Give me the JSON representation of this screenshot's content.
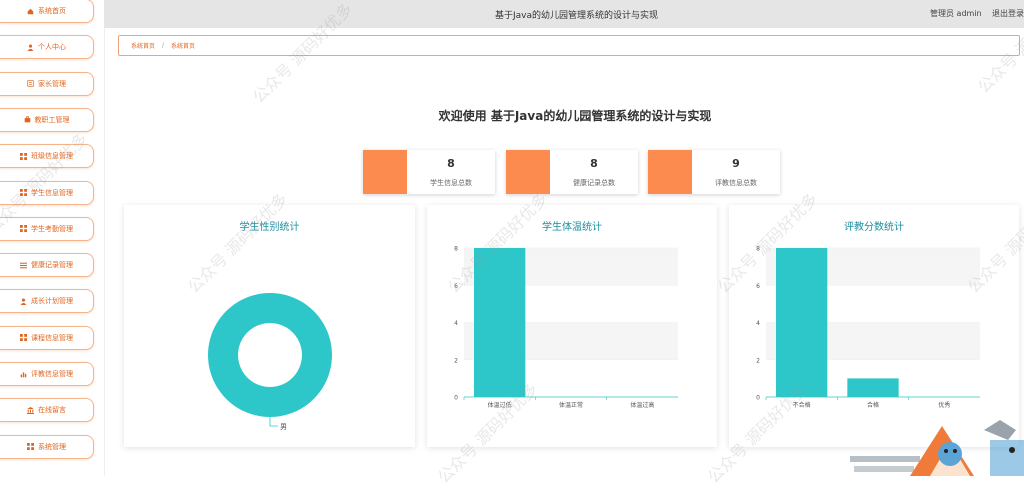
{
  "header": {
    "title": "基于Java的幼儿园管理系统的设计与实现",
    "user": "管理员 admin",
    "logout": "退出登录"
  },
  "sidebar": {
    "items": [
      {
        "label": "系统首页",
        "icon": "home-icon"
      },
      {
        "label": "个人中心",
        "icon": "person-icon"
      },
      {
        "label": "家长管理",
        "icon": "list-icon"
      },
      {
        "label": "教职工管理",
        "icon": "briefcase-icon"
      },
      {
        "label": "班级信息管理",
        "icon": "grid-icon"
      },
      {
        "label": "学生信息管理",
        "icon": "grid-icon"
      },
      {
        "label": "学生考勤管理",
        "icon": "grid-icon"
      },
      {
        "label": "健康记录管理",
        "icon": "menu-icon"
      },
      {
        "label": "成长计划管理",
        "icon": "person-icon"
      },
      {
        "label": "课程信息管理",
        "icon": "grid-icon"
      },
      {
        "label": "评教信息管理",
        "icon": "chart-icon"
      },
      {
        "label": "在线留言",
        "icon": "bank-icon"
      },
      {
        "label": "系统管理",
        "icon": "grid-icon"
      }
    ]
  },
  "breadcrumb": {
    "home": "系统首页",
    "sep": "/",
    "current": "系统首页"
  },
  "welcome": "欢迎使用 基于Java的幼儿园管理系统的设计与实现",
  "stats": [
    {
      "value": "8",
      "label": "学生信息总数"
    },
    {
      "value": "8",
      "label": "健康记录总数"
    },
    {
      "value": "9",
      "label": "评教信息总数"
    }
  ],
  "colors": {
    "accent": "#fb8b4e",
    "chart": "#2ec7c9",
    "title": "#1a8fa0"
  },
  "watermark": "公众号 源码好优多",
  "chart_data": [
    {
      "type": "pie",
      "title": "学生性别统计",
      "categories": [
        "男"
      ],
      "values": [
        8
      ],
      "style": "donut"
    },
    {
      "type": "bar",
      "title": "学生体温统计",
      "categories": [
        "体温过低",
        "体温正常",
        "体温过高"
      ],
      "values": [
        8,
        0,
        0
      ],
      "ylim": [
        0,
        8
      ],
      "yticks": [
        0,
        2,
        4,
        6,
        8
      ]
    },
    {
      "type": "bar",
      "title": "评教分数统计",
      "categories": [
        "不合格",
        "合格",
        "优秀"
      ],
      "values": [
        8,
        1,
        0
      ],
      "ylim": [
        0,
        8
      ],
      "yticks": [
        0,
        2,
        4,
        6,
        8
      ]
    }
  ]
}
